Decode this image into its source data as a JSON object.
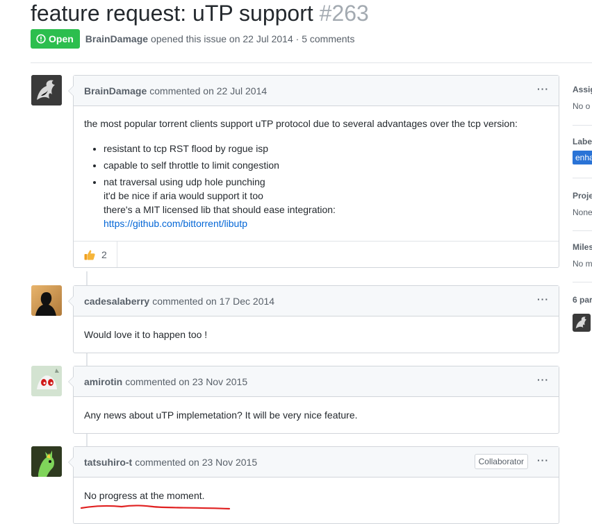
{
  "issue": {
    "title": "feature request: uTP support",
    "number": "#263",
    "state": "Open",
    "author": "BrainDamage",
    "opened_text": "opened this issue on 22 Jul 2014 · 5 comments"
  },
  "comments": [
    {
      "author": "BrainDamage",
      "action": "commented on 22 Jul 2014",
      "intro": "the most popular torrent clients support uTP protocol due to several advantages over the tcp version:",
      "bullets": [
        "resistant to tcp RST flood by rogue isp",
        "capable to self throttle to limit congestion",
        "nat traversal using udp hole punching"
      ],
      "continued_lines": [
        "it'd be nice if aria would support it too",
        "there's a MIT licensed lib that should ease integration:"
      ],
      "link": "https://github.com/bittorrent/libutp",
      "reaction_count": "2"
    },
    {
      "author": "cadesalaberry",
      "action": "commented on 17 Dec 2014",
      "body": "Would love it to happen too !"
    },
    {
      "author": "amirotin",
      "action": "commented on 23 Nov 2015",
      "body": "Any news about uTP implemetation? It will be very nice feature."
    },
    {
      "author": "tatsuhiro-t",
      "action": "commented on 23 Nov 2015",
      "badge": "Collaborator",
      "body": "No progress at the moment."
    }
  ],
  "menu_glyph": "···",
  "sidebar": {
    "assignees_label": "Assig",
    "assignees_value": "No o",
    "labels_label": "Label",
    "label_chip": "enha",
    "projects_label": "Proje",
    "projects_value": "None",
    "milestone_label": "Miles",
    "milestone_value": "No m",
    "participants_label": "6 par"
  },
  "colors": {
    "open_green": "#2cbe4e",
    "link_blue": "#0366d6",
    "label_blue": "#2a73d6",
    "scribble_red": "#e02020"
  }
}
